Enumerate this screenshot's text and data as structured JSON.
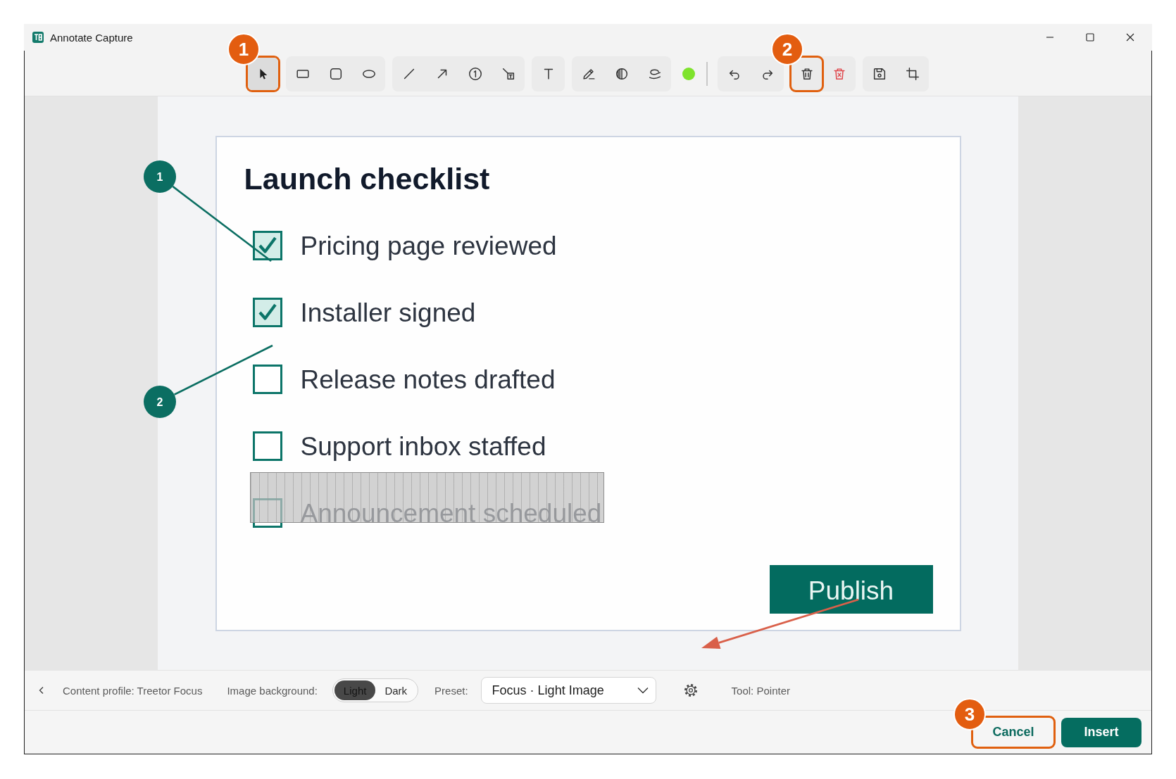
{
  "window": {
    "title": "Annotate Capture"
  },
  "toolbar": {
    "drawing_groups": [
      [
        {
          "kind": "pointer",
          "selected": true,
          "step": "1"
        }
      ],
      [
        {
          "kind": "rectangle",
          "selected": false
        },
        {
          "kind": "rounded-rectangle",
          "selected": false
        },
        {
          "kind": "ellipse",
          "selected": false
        }
      ],
      [
        {
          "kind": "line",
          "selected": false
        },
        {
          "kind": "arrow",
          "selected": false
        },
        {
          "kind": "counter",
          "selected": false
        },
        {
          "kind": "callout",
          "selected": false
        }
      ],
      [
        {
          "kind": "text",
          "selected": false
        }
      ],
      [
        {
          "kind": "highlighter",
          "selected": false
        },
        {
          "kind": "blur",
          "selected": false
        },
        {
          "kind": "lasso",
          "selected": false
        }
      ]
    ],
    "color_swatch": {
      "color": "#7ee32c"
    },
    "action_groups": [
      [
        {
          "kind": "undo"
        },
        {
          "kind": "redo"
        }
      ],
      [
        {
          "kind": "delete",
          "step": "2"
        },
        {
          "kind": "delete-all"
        }
      ],
      [
        {
          "kind": "save"
        },
        {
          "kind": "crop"
        }
      ]
    ]
  },
  "canvas": {
    "document": {
      "title": "Launch checklist",
      "items": [
        {
          "label": "Pricing page reviewed",
          "checked": true,
          "redacted": false
        },
        {
          "label": "Installer signed",
          "checked": true,
          "redacted": false
        },
        {
          "label": "Release notes drafted",
          "checked": false,
          "redacted": false
        },
        {
          "label": "Support inbox staffed",
          "checked": false,
          "redacted": false
        },
        {
          "label": "Announcement scheduled",
          "checked": false,
          "redacted": true
        }
      ],
      "button": "Publish"
    },
    "callouts": [
      {
        "label": "1"
      },
      {
        "label": "2"
      }
    ]
  },
  "status_bar": {
    "content_profile": "Content profile: Treetor Focus",
    "background_label": "Image background:",
    "background_options": [
      {
        "label": "Light",
        "selected": true
      },
      {
        "label": "Dark",
        "selected": false
      }
    ],
    "preset_label": "Preset:",
    "preset": {
      "value": "Focus · Light Image"
    },
    "tool_status": "Tool: Pointer"
  },
  "footer": {
    "buttons": [
      {
        "label": "Cancel",
        "kind": "secondary",
        "step": "3"
      },
      {
        "label": "Insert",
        "kind": "primary"
      }
    ]
  }
}
